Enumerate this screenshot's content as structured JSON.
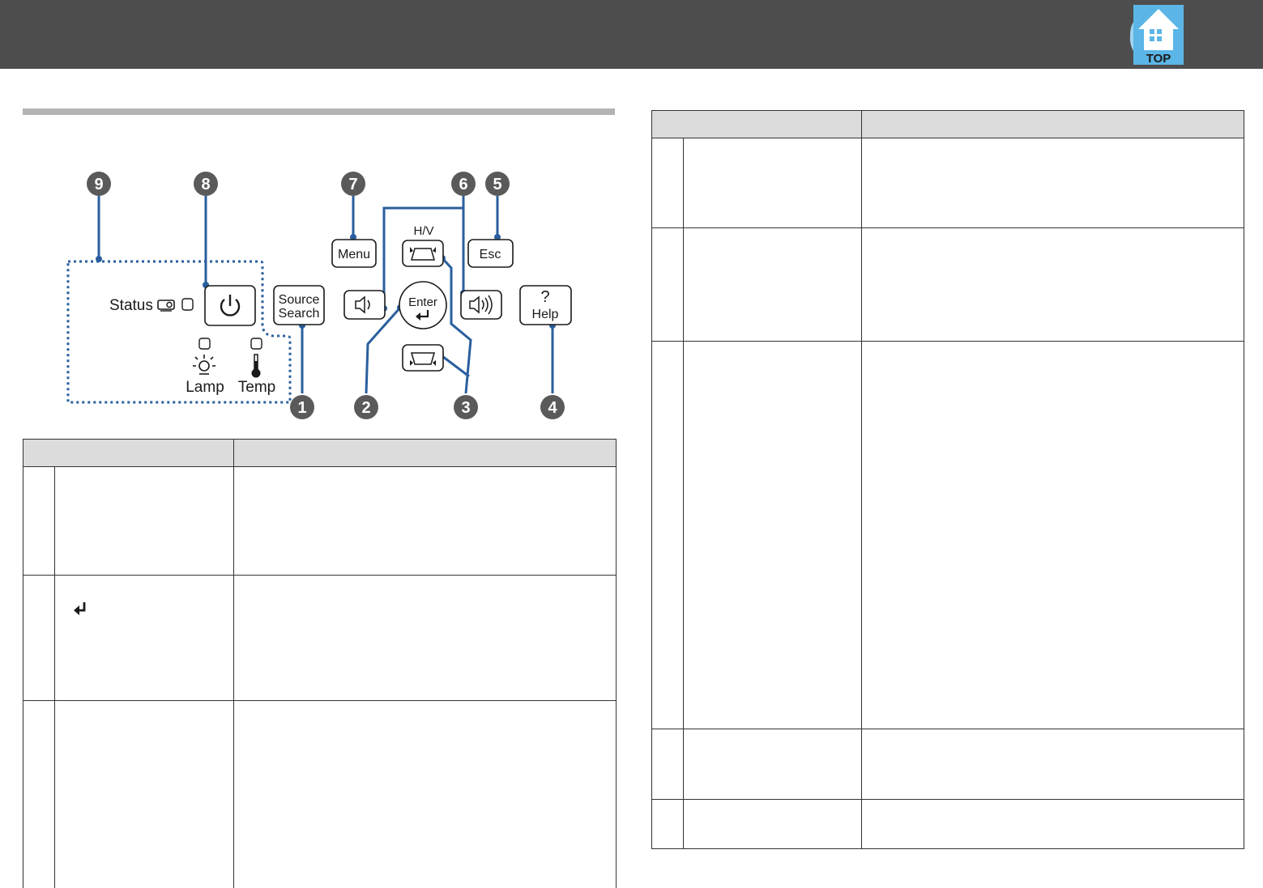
{
  "header": {
    "top_button": {
      "label": "TOP",
      "icon": "home-building-icon",
      "color": "#5bb5e6"
    }
  },
  "diagram": {
    "labels": {
      "status": "Status",
      "lamp": "Lamp",
      "temp": "Temp",
      "source": "Source",
      "search": "Search",
      "menu": "Menu",
      "hv": "H/V",
      "esc": "Esc",
      "enter": "Enter",
      "help": "Help"
    },
    "callouts": [
      "9",
      "8",
      "7",
      "6",
      "5",
      "1",
      "2",
      "3",
      "4"
    ],
    "colors": {
      "callout_fill": "#5a5a5a",
      "leader": "#2a5f9e",
      "dotted_frame": "#2a5f9e"
    }
  },
  "tables": {
    "left_rows": [
      {
        "icon": ""
      },
      {
        "icon": "enter-icon"
      },
      {
        "icon": ""
      }
    ],
    "right_rows": 5
  }
}
